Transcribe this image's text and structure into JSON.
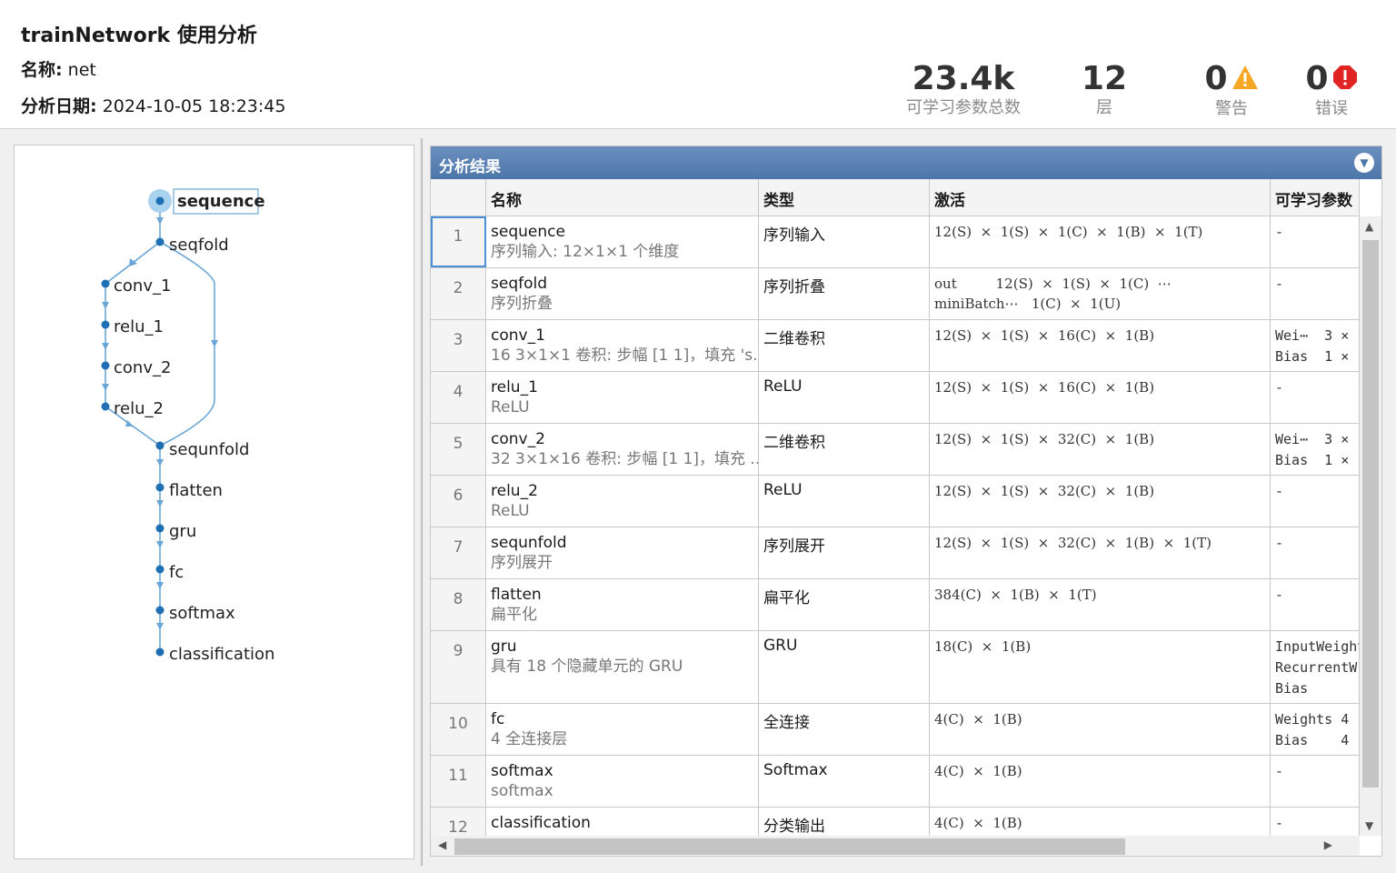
{
  "header": {
    "title": "trainNetwork 使用分析",
    "name_label": "名称:",
    "name_value": "net",
    "date_label": "分析日期:",
    "date_value": "2024-10-05 18:23:45"
  },
  "stats": {
    "params": {
      "value": "23.4k",
      "label": "可学习参数总数"
    },
    "layers": {
      "value": "12",
      "label": "层"
    },
    "warnings": {
      "value": "0",
      "label": "警告",
      "icon": "warning-icon",
      "color": "#f5a623"
    },
    "errors": {
      "value": "0",
      "label": "错误",
      "icon": "error-icon",
      "color": "#e02424"
    }
  },
  "graph": {
    "nodes": [
      "sequence",
      "seqfold",
      "conv_1",
      "relu_1",
      "conv_2",
      "relu_2",
      "sequnfold",
      "flatten",
      "gru",
      "fc",
      "softmax",
      "classification"
    ],
    "selected": "sequence",
    "edge_color": "#6aa6d6",
    "node_color": "#1f6fb5"
  },
  "results": {
    "title": "分析结果",
    "columns": {
      "name": "名称",
      "type": "类型",
      "act": "激活",
      "params": "可学习参数"
    },
    "rows": [
      {
        "idx": "1",
        "name": "sequence",
        "desc": "序列输入: 12×1×1 个维度",
        "type": "序列输入",
        "act": [
          "12(S)  ×  1(S)  ×  1(C)  ×  1(B)  ×  1(T)"
        ],
        "params": [
          "-"
        ]
      },
      {
        "idx": "2",
        "name": "seqfold",
        "desc": "序列折叠",
        "type": "序列折叠",
        "act": [
          "out         12(S)  ×  1(S)  ×  1(C)  ⋯",
          "miniBatch⋯   1(C)  ×  1(U)"
        ],
        "params": [
          "-"
        ]
      },
      {
        "idx": "3",
        "name": "conv_1",
        "desc": "16 3×1×1 卷积: 步幅 [1 1]，填充 's...",
        "type": "二维卷积",
        "act": [
          "12(S)  ×  1(S)  ×  16(C)  ×  1(B)"
        ],
        "params": [
          "Wei⋯  3 ×",
          "Bias  1 ×"
        ]
      },
      {
        "idx": "4",
        "name": "relu_1",
        "desc": "ReLU",
        "type": "ReLU",
        "act": [
          "12(S)  ×  1(S)  ×  16(C)  ×  1(B)"
        ],
        "params": [
          "-"
        ]
      },
      {
        "idx": "5",
        "name": "conv_2",
        "desc": "32 3×1×16 卷积: 步幅 [1 1]，填充 ...",
        "type": "二维卷积",
        "act": [
          "12(S)  ×  1(S)  ×  32(C)  ×  1(B)"
        ],
        "params": [
          "Wei⋯  3 ×",
          "Bias  1 ×"
        ]
      },
      {
        "idx": "6",
        "name": "relu_2",
        "desc": "ReLU",
        "type": "ReLU",
        "act": [
          "12(S)  ×  1(S)  ×  32(C)  ×  1(B)"
        ],
        "params": [
          "-"
        ]
      },
      {
        "idx": "7",
        "name": "sequnfold",
        "desc": "序列展开",
        "type": "序列展开",
        "act": [
          "12(S)  ×  1(S)  ×  32(C)  ×  1(B)  ×  1(T)"
        ],
        "params": [
          "-"
        ]
      },
      {
        "idx": "8",
        "name": "flatten",
        "desc": "扁平化",
        "type": "扁平化",
        "act": [
          "384(C)  ×  1(B)  ×  1(T)"
        ],
        "params": [
          "-"
        ]
      },
      {
        "idx": "9",
        "name": "gru",
        "desc": "具有 18 个隐藏单元的 GRU",
        "type": "GRU",
        "act": [
          "18(C)  ×  1(B)"
        ],
        "params": [
          "InputWeight",
          "RecurrentW",
          "Bias"
        ]
      },
      {
        "idx": "10",
        "name": "fc",
        "desc": "4 全连接层",
        "type": "全连接",
        "act": [
          "4(C)  ×  1(B)"
        ],
        "params": [
          "Weights 4",
          "Bias    4"
        ]
      },
      {
        "idx": "11",
        "name": "softmax",
        "desc": "softmax",
        "type": "Softmax",
        "act": [
          "4(C)  ×  1(B)"
        ],
        "params": [
          "-"
        ]
      },
      {
        "idx": "12",
        "name": "classification",
        "desc": "",
        "type": "分类输出",
        "act": [
          "4(C)  ×  1(B)"
        ],
        "params": [
          "-"
        ]
      }
    ]
  }
}
